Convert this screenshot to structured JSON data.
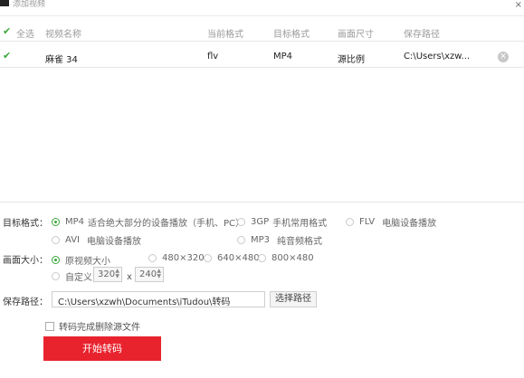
{
  "window": {
    "title": "添加视频",
    "close_glyph": "×"
  },
  "table": {
    "select_all_label": "全选",
    "columns": [
      "视频名称",
      "当前格式",
      "目标格式",
      "画面尺寸",
      "保存路径"
    ],
    "rows": [
      {
        "checked": true,
        "name": "麻雀 34",
        "current_format": "flv",
        "target_format": "MP4",
        "size": "源比例",
        "path": "C:\\Users\\xzw..."
      }
    ],
    "remove_glyph": "✕"
  },
  "target_format": {
    "label": "目标格式：",
    "options": [
      {
        "name": "MP4",
        "desc": "适合绝大部分的设备播放（手机、PC）",
        "selected": true
      },
      {
        "name": "3GP",
        "desc": "手机常用格式",
        "selected": false
      },
      {
        "name": "FLV",
        "desc": "电脑设备播放",
        "selected": false
      },
      {
        "name": "AVI",
        "desc": "电脑设备播放",
        "selected": false
      },
      {
        "name": "MP3",
        "desc": "纯音频格式",
        "selected": false
      }
    ]
  },
  "frame_size": {
    "label": "画面大小：",
    "options": [
      {
        "name": "原视频大小",
        "selected": true
      },
      {
        "name": "480×320",
        "selected": false
      },
      {
        "name": "640×480",
        "selected": false
      },
      {
        "name": "800×480",
        "selected": false
      },
      {
        "name": "自定义",
        "selected": false
      }
    ],
    "custom_width": "320",
    "custom_height": "240",
    "times": "x"
  },
  "save_path": {
    "label": "保存路径：",
    "value": "C:\\Users\\xzwh\\Documents\\iTudou\\转码",
    "browse_label": "选择路径"
  },
  "delete_source": {
    "checked": false,
    "label": "转码完成删除源文件"
  },
  "start_button": {
    "label": "开始转码",
    "color": "#e8232e"
  },
  "accent_color": "#3aa63a"
}
